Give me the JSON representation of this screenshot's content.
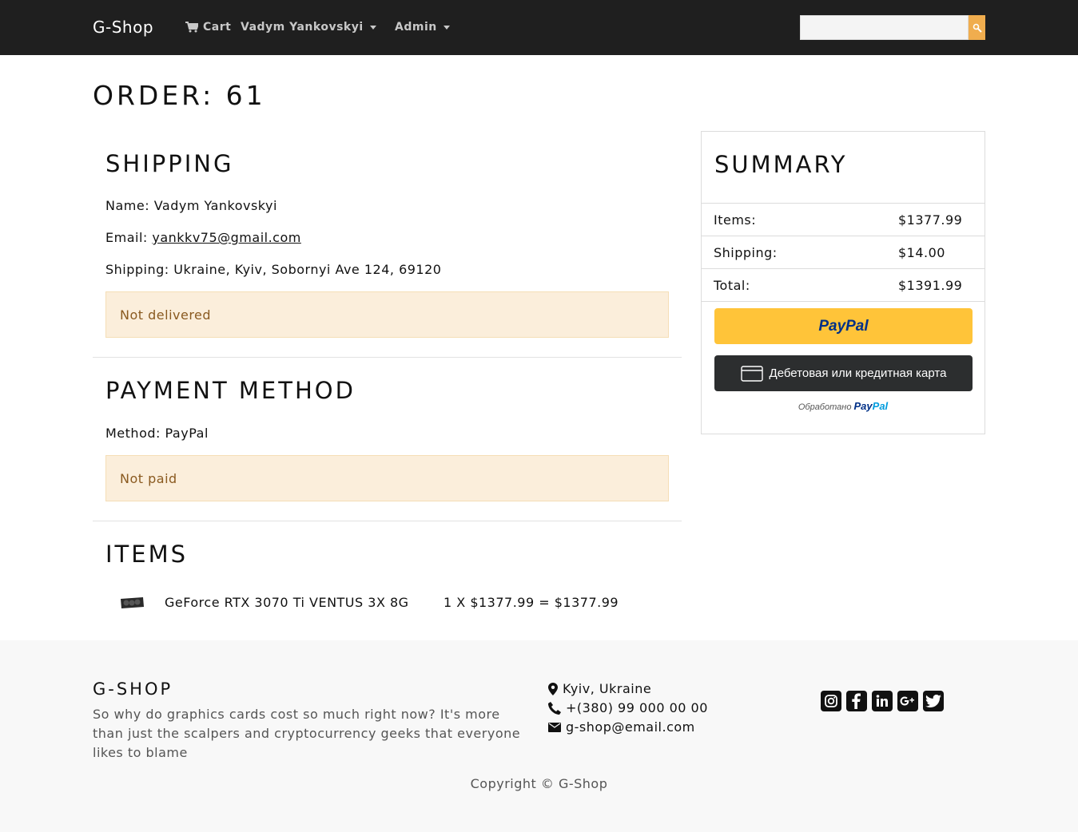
{
  "navbar": {
    "brand": "G-Shop",
    "cart_label": "Cart",
    "user_label": "Vadym Yankovskyi",
    "admin_label": "Admin",
    "search_value": ""
  },
  "order": {
    "title": "ORDER: 61"
  },
  "shipping": {
    "heading": "SHIPPING",
    "name_label": "Name:",
    "name_value": "Vadym Yankovskyi",
    "email_label": "Email:",
    "email_value": "yankkv75@gmail.com",
    "address_label": "Shipping:",
    "address_value": "Ukraine, Kyiv, Sobornyi Ave 124, 69120",
    "status": "Not delivered"
  },
  "payment": {
    "heading": "PAYMENT METHOD",
    "method_label": "Method:",
    "method_value": "PayPal",
    "status": "Not paid"
  },
  "items": {
    "heading": "ITEMS",
    "list": [
      {
        "name": "GeForce RTX 3070 Ti VENTUS 3X 8G",
        "calc": "1 X $1377.99 = $1377.99"
      }
    ]
  },
  "summary": {
    "heading": "SUMMARY",
    "rows": [
      {
        "label": "Items:",
        "value": "$1377.99"
      },
      {
        "label": "Shipping:",
        "value": "$14.00"
      },
      {
        "label": "Total:",
        "value": "$1391.99"
      }
    ],
    "paypal_button": "PayPal",
    "card_button": "Дебетовая или кредитная карта",
    "powered_prefix": "Обработано",
    "powered_brand_a": "Pay",
    "powered_brand_b": "Pal"
  },
  "footer": {
    "brand": "G-SHOP",
    "description": "So why do graphics cards cost so much right now? It's more than just the scalpers and cryptocurrency geeks that everyone likes to blame",
    "location": "Kyiv, Ukraine",
    "phone": "+(380) 99 000 00 00",
    "email": "g-shop@email.com",
    "socials": [
      "instagram-icon",
      "facebook-icon",
      "linkedin-icon",
      "google-plus-icon",
      "twitter-icon"
    ],
    "copyright": "Copyright © G-Shop"
  },
  "colors": {
    "navbar_bg": "#1f1f1f",
    "alert_bg": "#fbeedb",
    "alert_text": "#8a5a20",
    "search_btn": "#f0ad4e",
    "paypal_yellow": "#ffc439",
    "card_btn": "#2c2e2f",
    "footer_bg": "#f8f8f8"
  }
}
